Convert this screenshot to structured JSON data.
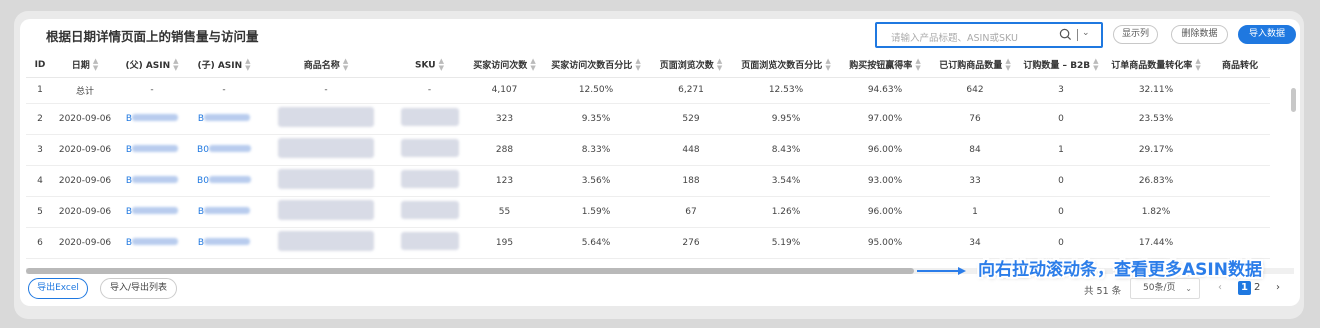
{
  "header": {
    "title": "根据日期详情页面上的销售量与访问量",
    "search_placeholder": "请输入产品标题、ASIN或SKU",
    "buttons": {
      "show_columns": "显示列",
      "delete_data": "删除数据",
      "import_data": "导入数据"
    }
  },
  "table": {
    "columns": [
      "ID",
      "日期",
      "(父) ASIN",
      "(子) ASIN",
      "商品名称",
      "SKU",
      "买家访问次数",
      "买家访问次数百分比",
      "页面浏览次数",
      "页面浏览次数百分比",
      "购买按钮赢得率",
      "已订购商品数量",
      "订购数量 – B2B",
      "订单商品数量转化率",
      "商品转化"
    ],
    "total_row": {
      "id": "1",
      "date": "总计",
      "parent_asin": "-",
      "child_asin": "-",
      "name": "-",
      "sku": "-",
      "visits": "4,107",
      "visits_pct": "12.50%",
      "views": "6,271",
      "views_pct": "12.53%",
      "buybox": "94.63%",
      "ordered": "642",
      "b2b": "3",
      "conversion": "32.11%"
    },
    "rows": [
      {
        "id": "2",
        "date": "2020-09-06",
        "parent_prefix": "B",
        "child_prefix": "B",
        "visits": "323",
        "visits_pct": "9.35%",
        "views": "529",
        "views_pct": "9.95%",
        "buybox": "97.00%",
        "ordered": "76",
        "b2b": "0",
        "conversion": "23.53%"
      },
      {
        "id": "3",
        "date": "2020-09-06",
        "parent_prefix": "B",
        "child_prefix": "B0",
        "visits": "288",
        "visits_pct": "8.33%",
        "views": "448",
        "views_pct": "8.43%",
        "buybox": "96.00%",
        "ordered": "84",
        "b2b": "1",
        "conversion": "29.17%"
      },
      {
        "id": "4",
        "date": "2020-09-06",
        "parent_prefix": "B",
        "child_prefix": "B0",
        "visits": "123",
        "visits_pct": "3.56%",
        "views": "188",
        "views_pct": "3.54%",
        "buybox": "93.00%",
        "ordered": "33",
        "b2b": "0",
        "conversion": "26.83%"
      },
      {
        "id": "5",
        "date": "2020-09-06",
        "parent_prefix": "B",
        "child_prefix": "B",
        "visits": "55",
        "visits_pct": "1.59%",
        "views": "67",
        "views_pct": "1.26%",
        "buybox": "96.00%",
        "ordered": "1",
        "b2b": "0",
        "conversion": "1.82%"
      },
      {
        "id": "6",
        "date": "2020-09-06",
        "parent_prefix": "B",
        "child_prefix": "B",
        "visits": "195",
        "visits_pct": "5.64%",
        "views": "276",
        "views_pct": "5.19%",
        "buybox": "95.00%",
        "ordered": "34",
        "b2b": "0",
        "conversion": "17.44%"
      }
    ]
  },
  "annotation": {
    "callout": "向右拉动滚动条，查看更多ASIN数据"
  },
  "footer": {
    "export_excel": "导出Excel",
    "import_export_list": "导入/导出列表",
    "total": "共 51 条",
    "page_size": "50条/页",
    "pages": [
      "1",
      "2"
    ],
    "prev": "‹",
    "next": "›"
  },
  "colors": {
    "accent": "#1f78e0",
    "callout": "#2b7de9"
  },
  "icons": [
    "search-icon",
    "chevron-down-icon",
    "sort-icon",
    "arrow-right-icon"
  ]
}
